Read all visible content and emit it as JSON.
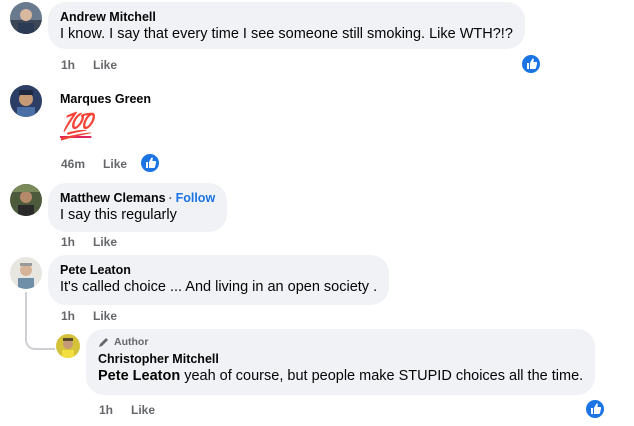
{
  "comments": [
    {
      "name": "Andrew Mitchell",
      "text": "I know. I say that every time I see someone still smoking. Like WTH?!?",
      "time": "1h",
      "like_label": "Like",
      "reaction_icon": "thumbs-up-icon"
    },
    {
      "name": "Marques Green",
      "text": "💯",
      "time": "46m",
      "like_label": "Like",
      "reaction_icon": "thumbs-up-icon"
    },
    {
      "name": "Matthew Clemans",
      "separator": "·",
      "follow_label": "Follow",
      "text": "I say this regularly",
      "time": "1h",
      "like_label": "Like"
    },
    {
      "name": "Pete Leaton",
      "text": "It's called choice ... And living in an open society .",
      "time": "1h",
      "like_label": "Like"
    }
  ],
  "reply": {
    "badge": "Author",
    "badge_icon": "pencil-icon",
    "name": "Christopher Mitchell",
    "mention": "Pete Leaton",
    "text": " yeah of course, but people make STUPID choices all the time.",
    "time": "1h",
    "like_label": "Like",
    "reaction_icon": "thumbs-up-icon"
  },
  "colors": {
    "bubble_bg": "#f0f2f5",
    "link_blue": "#1b74e4",
    "meta_gray": "#65676b",
    "hundred_red": "#e0245e"
  }
}
